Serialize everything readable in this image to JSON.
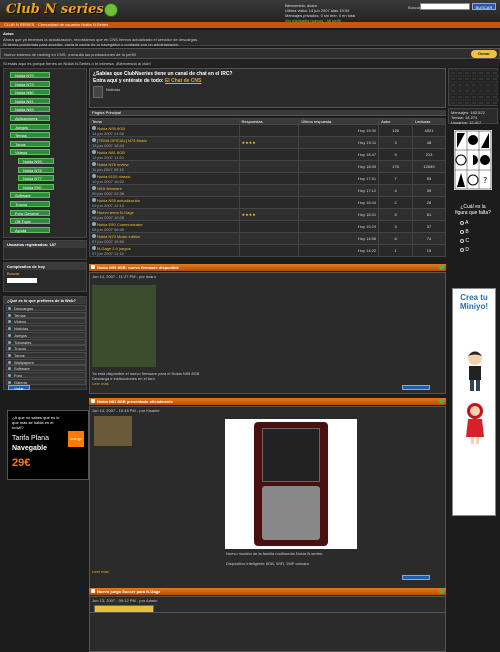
{
  "header": {
    "logo_text": "Club N series",
    "user_line1": "Bienvenido, dcaro",
    "user_line2": "Ultima visita: 14 jun 2007 alas 19:34",
    "user_line3": "Mensajes privados: 0 sin leer, 0 en total",
    "link_new": "Ver mensajes nuevos",
    "link_edit": "Mi perfil",
    "search_label": "Buscar",
    "search_placeholder": "",
    "search_button": "BUSCAR",
    "orange_bar_text": "CLUB N SERIES · Comunidad de usuarios Nokia N-Series"
  },
  "notice": {
    "title": "Aviso",
    "line1": "Ahora que ya tenemos la actualización, recordamos que en CNS hemos actualizado el servidor de descargas.",
    "line2": "Si tienes problemas para acceder, vacia la cache de tu navegador o contacta con un administrador."
  },
  "ad_bar": {
    "text": "Nuevo sistema de ranking en CNS: ¡consulta las puntuaciones de tu perfil!",
    "donate": "Donar"
  },
  "intro": "Si estás aquí es porque tienes un Nokia N-Series o te interesa. ¡Bienvenido al club!",
  "sidebar": {
    "categories": [
      "Nokia N70",
      "Nokia N73",
      "Nokia N80",
      "Nokia N91",
      "Nokia N93",
      "Aplicaciones",
      "Juegos",
      "Temas",
      "Tonos",
      "Videos",
      "Nokia N95",
      "Nokia N76",
      "Nokia N77",
      "Nokia E90",
      "Software",
      "Trucos",
      "Foro General",
      "Off-Topic",
      "Ayuda"
    ],
    "who_online": "Usuarios registrados: 187",
    "birthday_title": "Cumpleaños de hoy",
    "search_label": "Buscar",
    "quick_title": "¿Qué es lo que prefieres de la Web?",
    "quick_items": [
      "Descargas",
      "Temas",
      "Videos",
      "Noticias",
      "Juegos",
      "Tutoriales",
      "Trucos",
      "Tonos",
      "Wallpapers",
      "Software",
      "Foro",
      "Galeria"
    ],
    "quick_button": "Votar",
    "orange_ad": {
      "top": "¿A que no sabes qué es lo que más se habla en el móvil?",
      "plan": "Tarifa Plana",
      "net": "Navegable",
      "price": "29€",
      "brand": "orange"
    }
  },
  "main": {
    "irc_title": "¿Sabías que ClubNseries tiene un canal de chat en el IRC?",
    "irc_sub": "Entra aquí y entérate de todo:",
    "irc_link": "El Chat de CNS",
    "news_title": "Noticias",
    "section_title": "Página Principal",
    "table_head": [
      "Tema",
      "Respuestas",
      "Autor",
      "Última respuesta",
      "Lecturas"
    ],
    "threads": [
      {
        "title": "Nokia N95 8GB",
        "sub": "14 jun 2007 21:06",
        "last": "Hoy 19:30",
        "replies": "126",
        "views": "4521",
        "stars": ""
      },
      {
        "title": "[TEMA OFICIAL] N73 Music",
        "sub": "13 jun 2007 18:44",
        "last": "Hoy 19:11",
        "replies": "3",
        "views": "48",
        "stars": "★★★★"
      },
      {
        "title": "Nokia N81 8GB",
        "sub": "12 jun 2007 11:20",
        "last": "Hoy 18:47",
        "replies": "9",
        "views": "213",
        "stars": ""
      },
      {
        "title": "Nokia N76 review",
        "sub": "11 jun 2007 09:15",
        "last": "Hoy 18:05",
        "replies": "175",
        "views": "12849",
        "stars": ""
      },
      {
        "title": "Nokia 6120 classic",
        "sub": "10 jun 2007 16:02",
        "last": "Hoy 17:51",
        "replies": "7",
        "views": "55",
        "stars": ""
      },
      {
        "title": "N93i firmware",
        "sub": "09 jun 2007 22:38",
        "last": "Hoy 17:12",
        "replies": "4",
        "views": "39",
        "stars": ""
      },
      {
        "title": "Nokia N95 actualización",
        "sub": "09 jun 2007 12:10",
        "last": "Hoy 16:44",
        "replies": "2",
        "views": "26",
        "stars": ""
      },
      {
        "title": "Nuevo tema N-Gage",
        "sub": "08 jun 2007 10:05",
        "last": "Hoy 16:01",
        "replies": "5",
        "views": "61",
        "stars": "★★★★"
      },
      {
        "title": "Nokia E90 Communicator",
        "sub": "08 jun 2007 08:40",
        "last": "Hoy 15:29",
        "replies": "3",
        "views": "37",
        "stars": ""
      },
      {
        "title": "Nokia N70 Music edition",
        "sub": "07 jun 2007 19:55",
        "last": "Hoy 14:58",
        "replies": "6",
        "views": "74",
        "stars": ""
      },
      {
        "title": "N-Gage 2.0 juegos",
        "sub": "07 jun 2007 11:16",
        "last": "Hoy 14:22",
        "replies": "1",
        "views": "19",
        "stars": ""
      }
    ],
    "post1": {
      "title": "Nokia N95 8GB: nuevo firmware disponible",
      "date": "Jun 14, 2007 - 11:27 PM - por dcaro",
      "body1": "Ya está disponible el nuevo firmware para el Nokia N95 8GB.",
      "body2": "Descarga e instrucciones en el foro.",
      "more": "Leer más"
    },
    "post2": {
      "title": "Nokia N81 8GB presentado oficialmente",
      "date": "Jun 14, 2007 - 10:45 PM - por Kisame",
      "caption": "Nuevo modelo de la familia multimedia Nokia N-series.",
      "spec": "Dispositivo inteligente 8GB, WiFi, 2MP cámara",
      "more": "Leer más"
    },
    "post3": {
      "title": "Nuevo juego Soccer para N-Gage",
      "date": "Jun 13, 2007 - 09:12 PM - por Admin",
      "soccer": "SOCCER"
    }
  },
  "rside": {
    "stats": [
      "Mensajes: 183.522",
      "Temas: 18.274",
      "Usuarios: 12.417"
    ],
    "poll_q": "¿Cuál es la figura que falta?",
    "options": [
      "A",
      "B",
      "C",
      "D"
    ],
    "miniyo": "Crea tu Miniyo!"
  }
}
